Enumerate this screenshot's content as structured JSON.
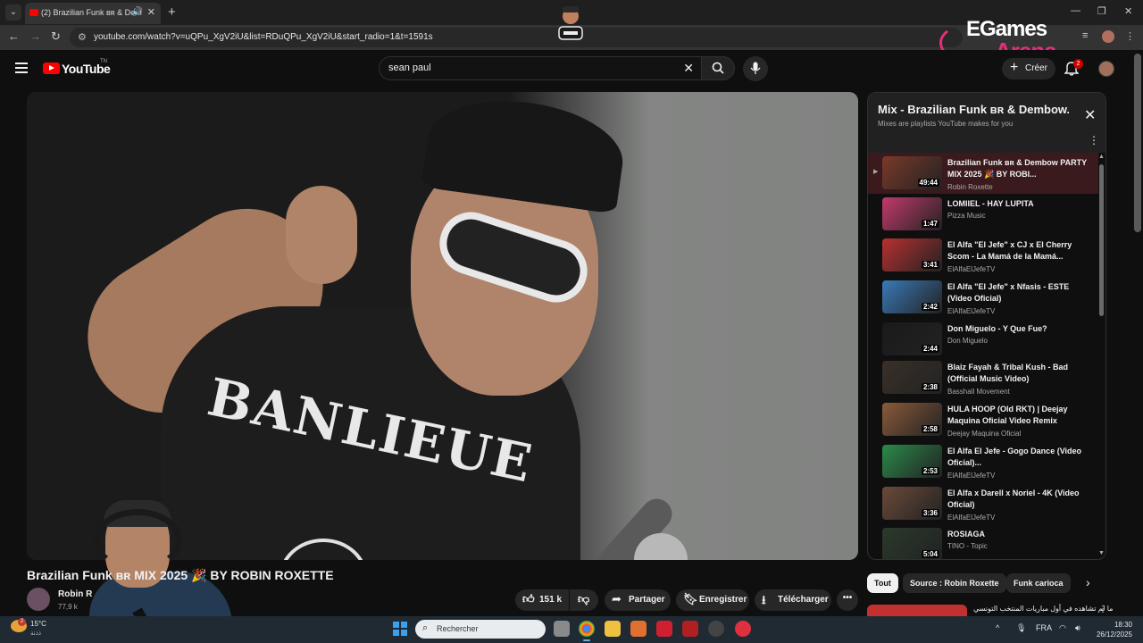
{
  "browser": {
    "tab_title": "(2) Brazilian Funk ʙʀ & Dem",
    "url": "youtube.com/watch?v=uQPu_XgV2iU&list=RDuQPu_XgV2iU&start_radio=1&t=1591s"
  },
  "overlay": {
    "brand_line1": "EGames",
    "brand_line2": "Arena"
  },
  "header": {
    "logo_text": "YouTube",
    "logo_suffix": "TN",
    "search_query": "sean paul",
    "create_label": "Créer",
    "notifications_count": "2"
  },
  "video": {
    "title": "Brazilian Funk ʙʀ                    MIX 2025 🎉 BY ROBIN ROXETTE",
    "shirt_text": "BANLIEUE",
    "channel_name": "Robin R",
    "channel_subs": "77,9 k",
    "likes": "151 k",
    "share_label": "Partager",
    "save_label": "Enregistrer",
    "download_label": "Télécharger"
  },
  "playlist": {
    "title": "Mix - Brazilian Funk ʙʀ & Dembow...",
    "subtitle": "Mixes are playlists YouTube makes for you",
    "items": [
      {
        "title": "Brazilian Funk ʙʀ & Dembow PARTY MIX 2025 🎉 BY ROBI...",
        "channel": "Robin Roxette",
        "duration": "49:44",
        "color": "#7a3a2a"
      },
      {
        "title": "LOMIIEL - HAY LUPITA",
        "channel": "Pizza Music",
        "duration": "1:47",
        "color": "#c23a6a"
      },
      {
        "title": "El Alfa \"El Jefe\" x CJ x El Cherry Scom - La Mamá de la Mamá...",
        "channel": "ElAlfaElJefeTV",
        "duration": "3:41",
        "color": "#b83030"
      },
      {
        "title": "El Alfa \"El Jefe\" x Nfasis - ESTE (Video Oficial)",
        "channel": "ElAlfaElJefeTV",
        "duration": "2:42",
        "color": "#3a7ab8"
      },
      {
        "title": "Don Miguelo - Y Que Fue?",
        "channel": "Don Miguelo",
        "duration": "2:44",
        "color": "#1a1a1a"
      },
      {
        "title": "Blaiz Fayah & Tribal Kush - Bad (Official Music Video)",
        "channel": "Basshall Movement",
        "duration": "2:38",
        "color": "#3a3028"
      },
      {
        "title": "HULA HOOP (Old RKT) | Deejay Maquina Oficial Video Remix",
        "channel": "Deejay Maquina Oficial",
        "duration": "2:58",
        "color": "#8a5a3a"
      },
      {
        "title": "El Alfa El Jefe - Gogo Dance (Video Oficial)...",
        "channel": "ElAlfaElJefeTV",
        "duration": "2:53",
        "color": "#2a8a4a"
      },
      {
        "title": "El Alfa x Darell x Noriel - 4K (Video Oficial)",
        "channel": "ElAlfaElJefeTV",
        "duration": "3:36",
        "color": "#6a4a3a"
      },
      {
        "title": "ROSIAGA",
        "channel": "TINO - Topic",
        "duration": "5:04",
        "color": "#2a3a2a"
      }
    ]
  },
  "chips": [
    "Tout",
    "Source : Robin Roxette",
    "Funk carioca"
  ],
  "recommendation": {
    "title": "ما لم تشاهده في أول مباريات المنتخب التونسي"
  },
  "taskbar": {
    "temperature": "15°C",
    "weather_text": "ذذنة",
    "weather_badge": "2",
    "search_placeholder": "Rechercher",
    "language": "FRA",
    "time": "18:30",
    "date": "26/12/2025"
  }
}
